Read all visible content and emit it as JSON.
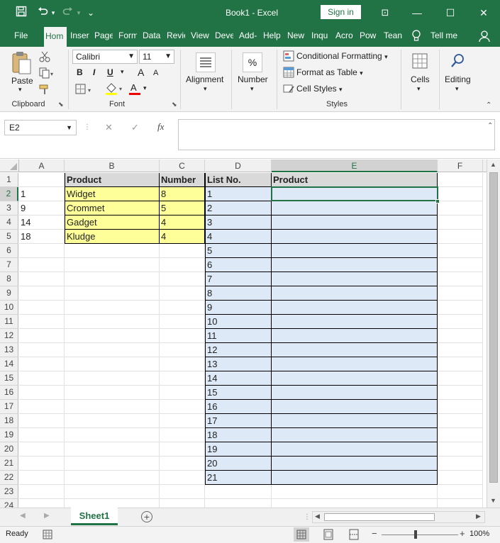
{
  "window": {
    "title": "Book1 - Excel",
    "sign_in": "Sign in",
    "minimize": "—",
    "maximize": "☐",
    "close": "✕",
    "ribbon_display": "⊡",
    "qat_more": "⌄"
  },
  "tabs": [
    "File",
    "Hom",
    "Inser",
    "Page",
    "Form",
    "Data",
    "Revie",
    "View",
    "Deve",
    "Add-",
    "Help",
    "New",
    "Inqu",
    "Acro",
    "Pow",
    "Tean"
  ],
  "tell_me": "Tell me",
  "ribbon": {
    "clipboard": {
      "paste": "Paste",
      "label": "Clipboard"
    },
    "font": {
      "name": "Calibri",
      "size": "11",
      "bold": "B",
      "italic": "I",
      "underline": "U",
      "grow": "A",
      "shrink": "A",
      "font_color": "A",
      "label": "Font"
    },
    "alignment": {
      "label": "Alignment"
    },
    "number": {
      "label": "Number",
      "icon": "%"
    },
    "styles": {
      "conditional": "Conditional Formatting",
      "format_table": "Format as Table",
      "cell_styles": "Cell Styles",
      "label": "Styles"
    },
    "cells": {
      "label": "Cells"
    },
    "editing": {
      "label": "Editing"
    }
  },
  "formula_bar": {
    "name_box": "E2",
    "fx": "fx",
    "cancel": "✕",
    "enter": "✓",
    "formula": ""
  },
  "columns": [
    "A",
    "B",
    "C",
    "D",
    "E",
    "F"
  ],
  "rows": [
    "1",
    "2",
    "3",
    "4",
    "5",
    "6",
    "7",
    "8",
    "9",
    "10",
    "11",
    "12",
    "13",
    "14",
    "15",
    "16",
    "17",
    "18",
    "19",
    "20",
    "21",
    "22",
    "23",
    "24"
  ],
  "sheet": {
    "headers": {
      "b": "Product",
      "c": "Number",
      "d": "List No.",
      "e": "Product"
    },
    "lookup": [
      {
        "a": "1",
        "b": "Widget",
        "c": "8"
      },
      {
        "a": "9",
        "b": "Crommet",
        "c": "5"
      },
      {
        "a": "14",
        "b": "Gadget",
        "c": "4"
      },
      {
        "a": "18",
        "b": "Kludge",
        "c": "4"
      }
    ],
    "list_no": [
      "1",
      "2",
      "3",
      "4",
      "5",
      "6",
      "7",
      "8",
      "9",
      "10",
      "11",
      "12",
      "13",
      "14",
      "15",
      "16",
      "17",
      "18",
      "19",
      "20",
      "21"
    ]
  },
  "sheet_tabs": {
    "active": "Sheet1",
    "add": "+"
  },
  "status": {
    "ready": "Ready",
    "zoom": "100%",
    "zoom_minus": "−",
    "zoom_plus": "+"
  },
  "colors": {
    "accent": "#217346",
    "yellow_fill": "#ffff99",
    "blue_fill": "#dde9f6",
    "header_fill": "#d9d9d9"
  }
}
